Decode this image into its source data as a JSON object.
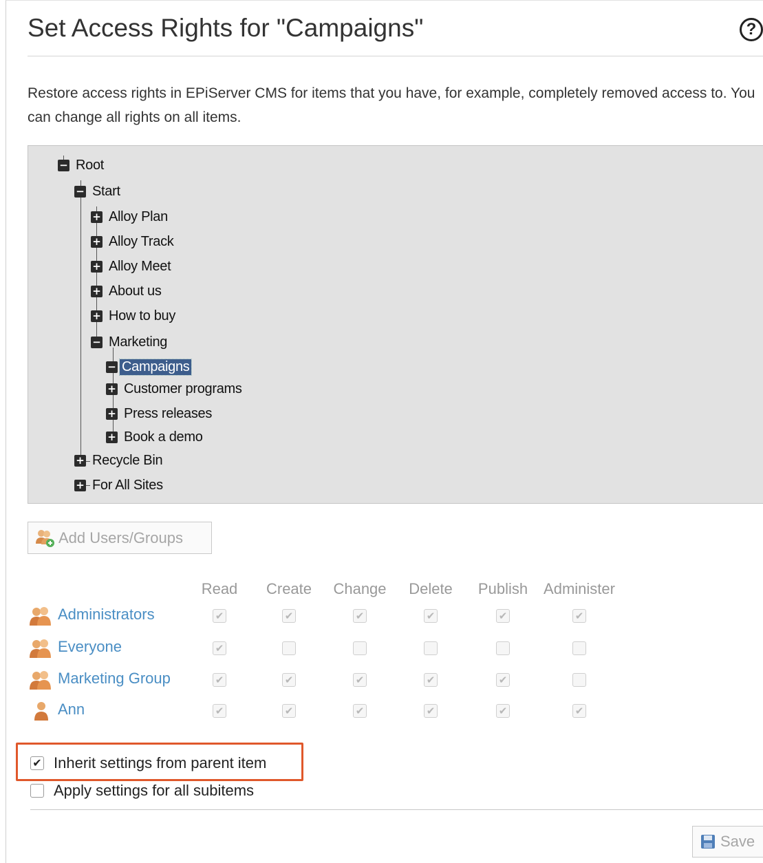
{
  "title": "Set Access Rights for  \"Campaigns\"",
  "help_symbol": "?",
  "description": "Restore access rights in EPiServer CMS for items that you have, for example, completely removed access to. You can change all rights on all items.",
  "tree": [
    {
      "label": "Root",
      "expanded": true,
      "selected": false
    },
    {
      "label": "Start",
      "expanded": true,
      "selected": false
    },
    {
      "label": "Alloy Plan",
      "expanded": false,
      "selected": false
    },
    {
      "label": "Alloy Track",
      "expanded": false,
      "selected": false
    },
    {
      "label": "Alloy Meet",
      "expanded": false,
      "selected": false
    },
    {
      "label": "About us",
      "expanded": false,
      "selected": false
    },
    {
      "label": "How to buy",
      "expanded": false,
      "selected": false
    },
    {
      "label": "Marketing",
      "expanded": true,
      "selected": false
    },
    {
      "label": "Campaigns",
      "expanded": true,
      "selected": true
    },
    {
      "label": "Customer programs",
      "expanded": false,
      "selected": false
    },
    {
      "label": "Press releases",
      "expanded": false,
      "selected": false
    },
    {
      "label": "Book a demo",
      "expanded": false,
      "selected": false
    },
    {
      "label": "Recycle Bin",
      "expanded": false,
      "selected": false
    },
    {
      "label": "For All Sites",
      "expanded": false,
      "selected": false
    }
  ],
  "add_button_label": "Add Users/Groups",
  "columns": [
    "Read",
    "Create",
    "Change",
    "Delete",
    "Publish",
    "Administer"
  ],
  "principals": [
    {
      "name": "Administrators",
      "type": "group",
      "rights": [
        true,
        true,
        true,
        true,
        true,
        true
      ]
    },
    {
      "name": "Everyone",
      "type": "group",
      "rights": [
        true,
        false,
        false,
        false,
        false,
        false
      ]
    },
    {
      "name": "Marketing Group",
      "type": "group",
      "rights": [
        true,
        true,
        true,
        true,
        true,
        false
      ]
    },
    {
      "name": "Ann",
      "type": "user",
      "rights": [
        true,
        true,
        true,
        true,
        true,
        true
      ]
    }
  ],
  "options": [
    {
      "label": "Inherit settings from parent item",
      "checked": true
    },
    {
      "label": "Apply settings for all subitems",
      "checked": false
    }
  ],
  "save_label": "Save",
  "colors": {
    "link": "#4a8ec4",
    "highlight_border": "#e0582b",
    "tree_bg": "#e2e2e2",
    "selection": "#3d5d8c"
  }
}
